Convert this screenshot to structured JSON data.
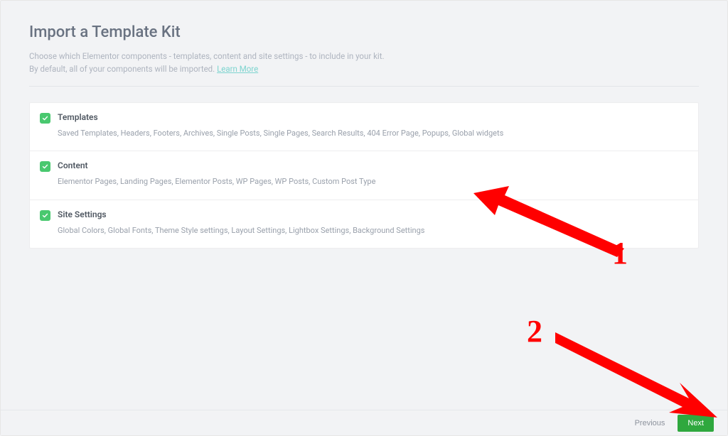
{
  "header": {
    "title": "Import a Template Kit",
    "description_line1": "Choose which Elementor components - templates, content and site settings - to include in your kit.",
    "description_line2": "By default, all of your components will be imported. ",
    "learn_more": "Learn More"
  },
  "options": [
    {
      "title": "Templates",
      "desc": "Saved Templates, Headers, Footers, Archives, Single Posts, Single Pages, Search Results, 404 Error Page, Popups, Global widgets",
      "checked": true
    },
    {
      "title": "Content",
      "desc": "Elementor Pages, Landing Pages, Elementor Posts, WP Pages, WP Posts, Custom Post Type",
      "checked": true
    },
    {
      "title": "Site Settings",
      "desc": "Global Colors, Global Fonts, Theme Style settings, Layout Settings, Lightbox Settings, Background Settings",
      "checked": true
    }
  ],
  "footer": {
    "previous": "Previous",
    "next": "Next"
  },
  "annotations": {
    "label1": "1",
    "label2": "2"
  }
}
